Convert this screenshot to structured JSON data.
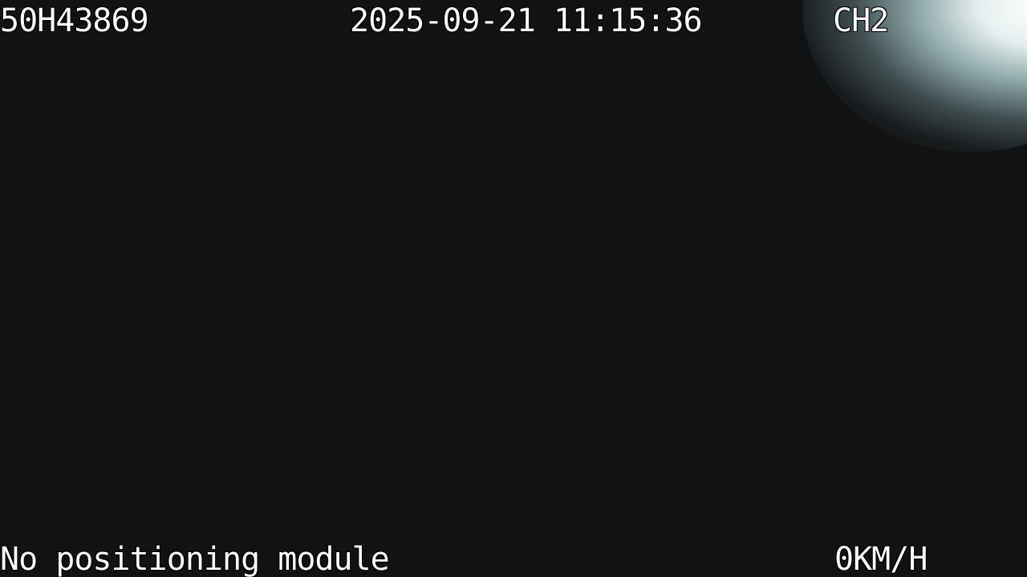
{
  "osd": {
    "vehicle_id": "50H43869",
    "datetime": "2025-09-21 11:15:36",
    "channel": "CH2",
    "gps_status": "No positioning module",
    "speed": "0KM/H"
  },
  "colors": {
    "background": "#111213",
    "text": "#ffffff",
    "glare": "#e6f5f5"
  }
}
